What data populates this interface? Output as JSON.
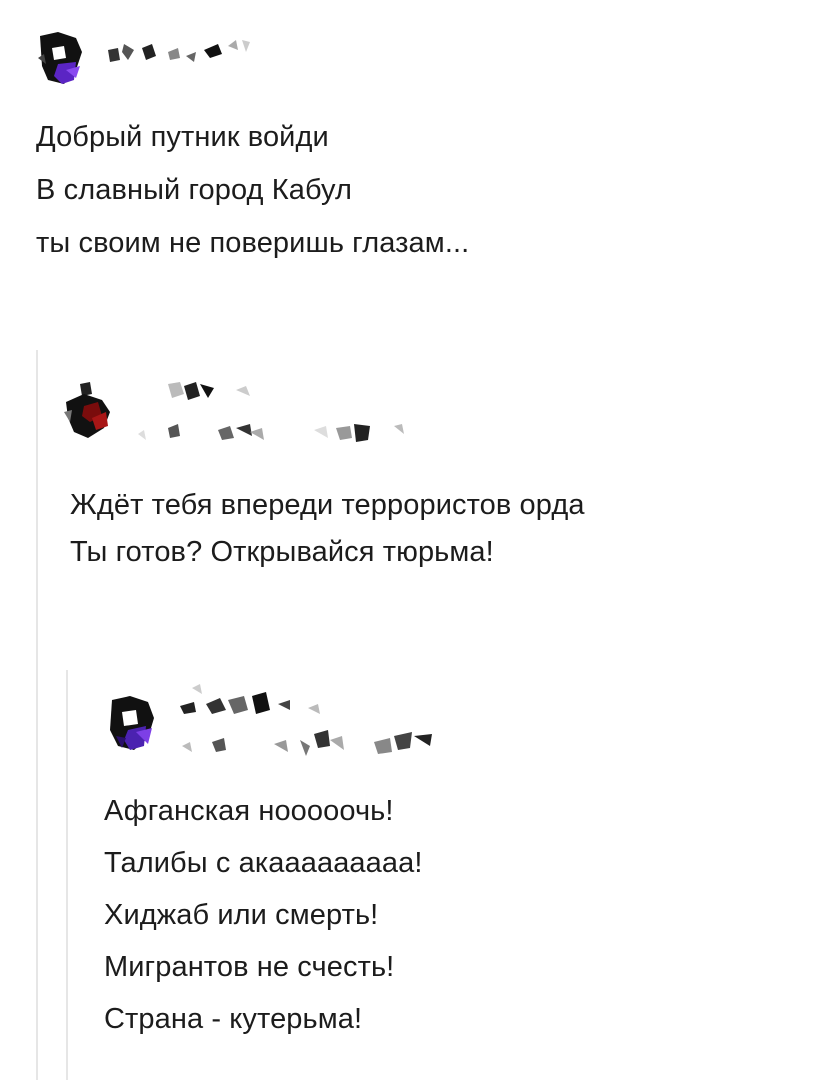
{
  "post": {
    "lines": [
      "Добрый путник войди",
      "В славный город Кабул",
      "ты своим не поверишь глазам..."
    ]
  },
  "reply1": {
    "lines": [
      "Ждёт тебя впереди террористов орда",
      "Ты готов? Открывайся тюрьма!"
    ]
  },
  "reply2": {
    "lines": [
      "Афганская нооооочь!",
      "Талибы с акааааааааа!",
      "Хиджаб или смерть!",
      "Мигрантов не счесть!",
      "Страна - кутерьма!"
    ]
  },
  "colors": {
    "avatar_purple": "#6a2bd0",
    "avatar_dark": "#111111",
    "avatar_red": "#8b1010",
    "thread_line": "#e6e6e6"
  }
}
